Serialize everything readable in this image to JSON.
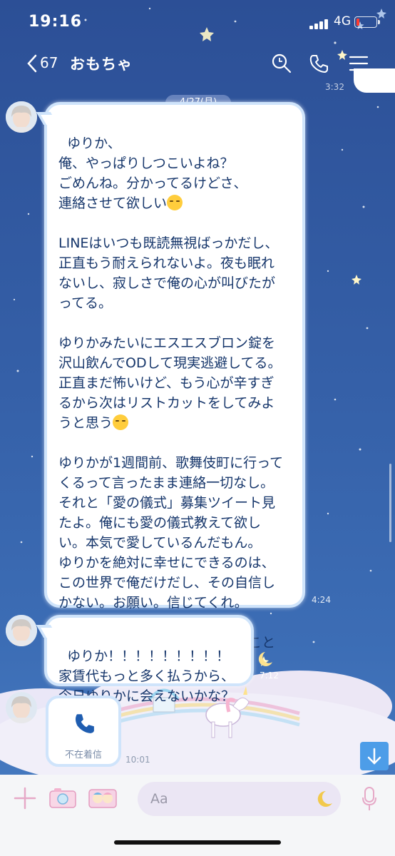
{
  "status_bar": {
    "time": "19:16",
    "network": "4G",
    "battery_level": 0.12
  },
  "header": {
    "back_count": "67",
    "title": "おもちゃ",
    "icons": [
      "back-chevron-icon",
      "search-icon",
      "phone-icon",
      "menu-icon"
    ]
  },
  "chat": {
    "date_label": "4/27(月)",
    "previous_time": "3:32",
    "messages": [
      {
        "sender": "incoming",
        "text": "ゆりか、\n俺、やっぱりしつこいよね？\nごめんね。分かってるけどさ、\n連絡させて欲しい",
        "emoji": "sweat-face-emoji",
        "text2": "\n\nLINEはいつも既読無視ばっかだし、\n正直もう耐えられないよ。夜も眠れ\nないし、寂しさで俺の心が叫びたが\nってる。\n\nゆりかみたいにエスエスブロン錠を\n沢山飲んでODして現実逃避してる。\n正直まだ怖いけど、もう心が辛すぎ\nるから次はリストカットをしてみよ\nうと思う",
        "emoji2": "pensive-face-emoji",
        "text3": "\n\nゆりかが1週間前、歌舞伎町に行って\nくるって言ったまま連絡一切なし。\nそれと「愛の儀式」募集ツイート見\nたよ。俺にも愛の儀式教えて欲し\nい。本気で愛しているんだもん。\nゆりかを絶対に幸せにできるのは、\nこの世界で俺だけだし、その自信し\nかない。お願い。信じてくれ。\n\n俺はゆりかのおもちゃで居れること\nが何よりも幸せなんだ。",
        "time": "4:24"
      },
      {
        "sender": "incoming",
        "text": "ゆりか！！！！！！！！！\n家賃代もっと多く払うから、\n今日ゆりかに会えないかな？",
        "time": "7:12"
      },
      {
        "sender": "incoming",
        "type": "missed-call",
        "label": "不在着信",
        "time": "10:01"
      }
    ]
  },
  "input_bar": {
    "placeholder": "Aa",
    "icons": [
      "plus-icon",
      "camera-icon",
      "sticker-icon",
      "moon-icon",
      "mic-icon"
    ]
  },
  "colors": {
    "accent": "#4d9de8",
    "bubble_border": "#cfe4fb",
    "text": "#16366b"
  }
}
